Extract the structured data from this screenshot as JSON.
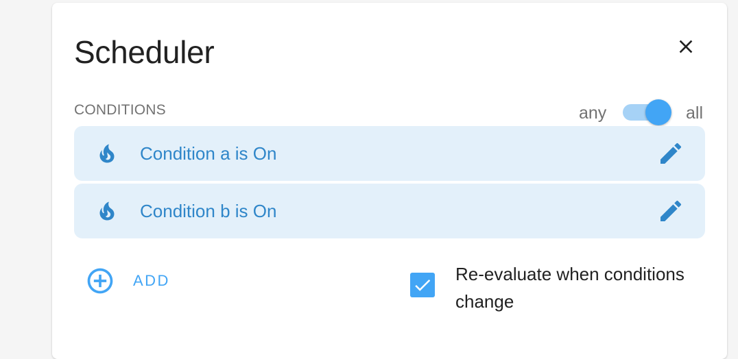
{
  "dialog": {
    "title": "Scheduler"
  },
  "conditions": {
    "section_label": "CONDITIONS",
    "toggle": {
      "left_label": "any",
      "right_label": "all",
      "selected": "all"
    },
    "items": [
      {
        "label": "Condition a is On",
        "icon": "fire-icon"
      },
      {
        "label": "Condition b is On",
        "icon": "fire-icon"
      }
    ],
    "add_label": "ADD",
    "reevaluate": {
      "checked": true,
      "label": "Re-evaluate when conditions change"
    }
  },
  "colors": {
    "accent": "#42a5f5",
    "row_background": "#e3f0fa",
    "condition_text": "#2f86c9"
  }
}
